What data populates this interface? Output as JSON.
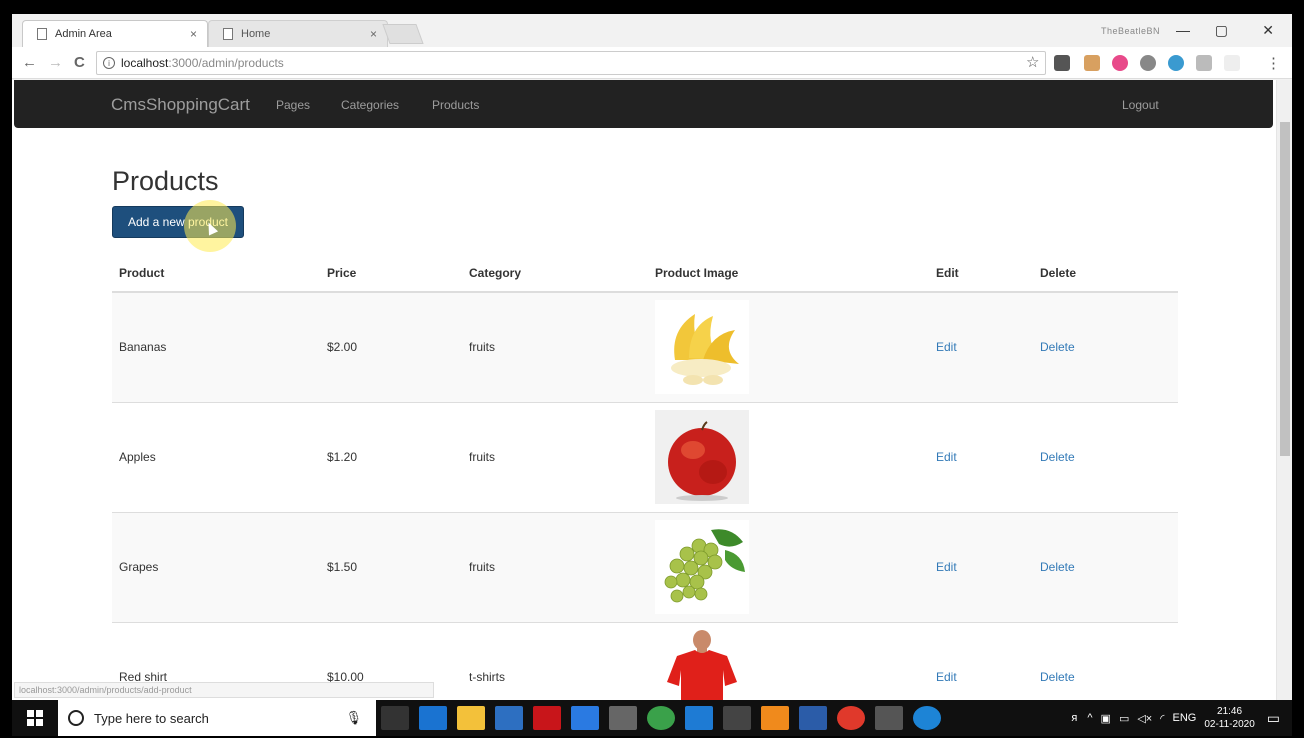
{
  "browser": {
    "tabs": [
      {
        "title": "Admin Area",
        "close": "×"
      },
      {
        "title": "Home",
        "close": "×"
      }
    ],
    "profile_name": "TheBeatleBN",
    "url_host": "localhost",
    "url_path": ":3000/admin/products",
    "back": "←",
    "forward": "→",
    "reload": "C",
    "star": "☆",
    "menu": "⋮",
    "minimize": "—",
    "restore": "▢",
    "close": "✕",
    "status_link": "localhost:3000/admin/products/add-product"
  },
  "navbar": {
    "brand": "CmsShoppingCart",
    "links": [
      "Pages",
      "Categories",
      "Products"
    ],
    "logout": "Logout"
  },
  "main": {
    "title": "Products",
    "add_button": "Add a new product",
    "table": {
      "headers": [
        "Product",
        "Price",
        "Category",
        "Product Image",
        "Edit",
        "Delete"
      ],
      "rows": [
        {
          "product": "Bananas",
          "price": "$2.00",
          "category": "fruits",
          "image": "banana-image",
          "edit": "Edit",
          "delete": "Delete"
        },
        {
          "product": "Apples",
          "price": "$1.20",
          "category": "fruits",
          "image": "apple-image",
          "edit": "Edit",
          "delete": "Delete"
        },
        {
          "product": "Grapes",
          "price": "$1.50",
          "category": "fruits",
          "image": "grapes-image",
          "edit": "Edit",
          "delete": "Delete"
        },
        {
          "product": "Red shirt",
          "price": "$10.00",
          "category": "t-shirts",
          "image": "red-shirt-image",
          "edit": "Edit",
          "delete": "Delete"
        }
      ]
    }
  },
  "taskbar": {
    "search_placeholder": "Type here to search",
    "language": "ENG",
    "time": "21:46",
    "date": "02-11-2020"
  }
}
